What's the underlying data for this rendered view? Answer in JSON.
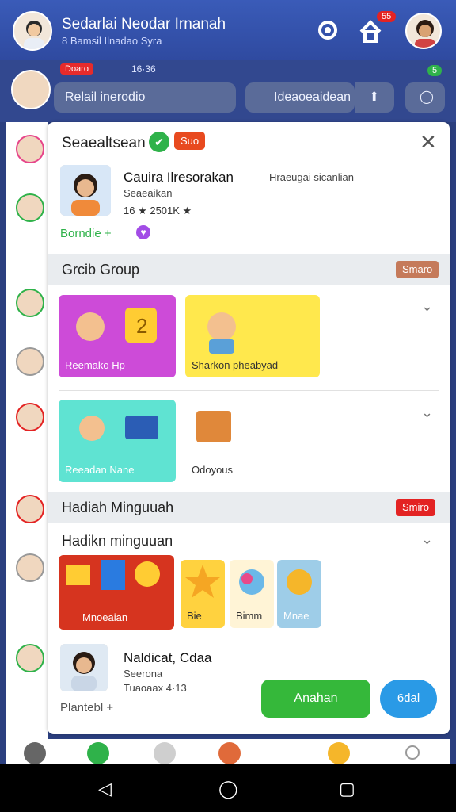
{
  "header": {
    "title": "Sedarlai Neodar Irnanah",
    "subtitle": "8 Bamsil Ilnadao Syra",
    "badge_count": "55",
    "icons": [
      "location-icon",
      "home-icon"
    ]
  },
  "row2": {
    "chip": "Doaro",
    "meta": "16·36",
    "status": "Relail inerodio",
    "search": "Ideaoeaidean",
    "right_badge": "5"
  },
  "card": {
    "title": "Seaealtsean",
    "chip": "Suo",
    "profile": {
      "name": "Cauira Ilresorakan",
      "extra": "Hraeugai sicanlian",
      "sub": "Seaeaikan",
      "stats": "16 ★ 2501K ★",
      "link": "Borndie +"
    },
    "section1": {
      "title": "Grcib Group",
      "button": "Smaro"
    },
    "tiles_row1": [
      {
        "label": "Reemako   Hp"
      },
      {
        "label": "Sharkon pheabyad"
      }
    ],
    "tiles_row2": [
      {
        "label": "Reeadan Nane"
      },
      {
        "label": "Odoyous"
      }
    ],
    "section2": {
      "title": "Hadiah Minguuah",
      "button": "Smiro"
    },
    "sub_section": {
      "title": "Hadikn minguuan"
    },
    "gift_tiles": [
      {
        "label": "Mnoeaian"
      },
      {
        "label": "Bie"
      },
      {
        "label": "Bimm"
      },
      {
        "label": "Mnae"
      }
    ],
    "footer_profile": {
      "name": "Naldicat, Cdaa",
      "sub": "Seerona",
      "meta": "Tuaoaax 4·13",
      "link": "Plantebl +"
    },
    "primary_button": "Anahan",
    "secondary_button": "6dal"
  },
  "colors": {
    "header": "#3a5bb8",
    "green": "#35b83a",
    "blue": "#2a9ae6",
    "red": "#e32323"
  }
}
